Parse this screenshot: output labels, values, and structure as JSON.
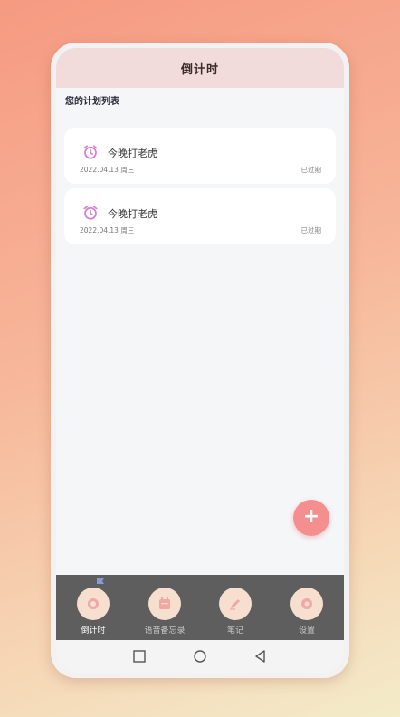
{
  "header": {
    "title": "倒计时"
  },
  "section": {
    "title": "您的计划列表"
  },
  "plans": [
    {
      "name": "今晚打老虎",
      "date": "2022.04.13 周三",
      "status": "已过期"
    },
    {
      "name": "今晚打老虎",
      "date": "2022.04.13 周三",
      "status": "已过期"
    }
  ],
  "fab": {
    "label": "+"
  },
  "tabs": [
    {
      "label": "倒计时",
      "icon": "alarm-icon",
      "active": true
    },
    {
      "label": "语音备忘录",
      "icon": "calendar-icon",
      "active": false
    },
    {
      "label": "笔记",
      "icon": "pen-icon",
      "active": false
    },
    {
      "label": "设置",
      "icon": "gear-icon",
      "active": false
    }
  ],
  "colors": {
    "accent": "#f58f8f",
    "header_bg": "#f1dcdb",
    "tab_bg": "#5e5e5e",
    "tab_circle": "#f7dfcf",
    "clock_icon": "#d97bd0"
  }
}
